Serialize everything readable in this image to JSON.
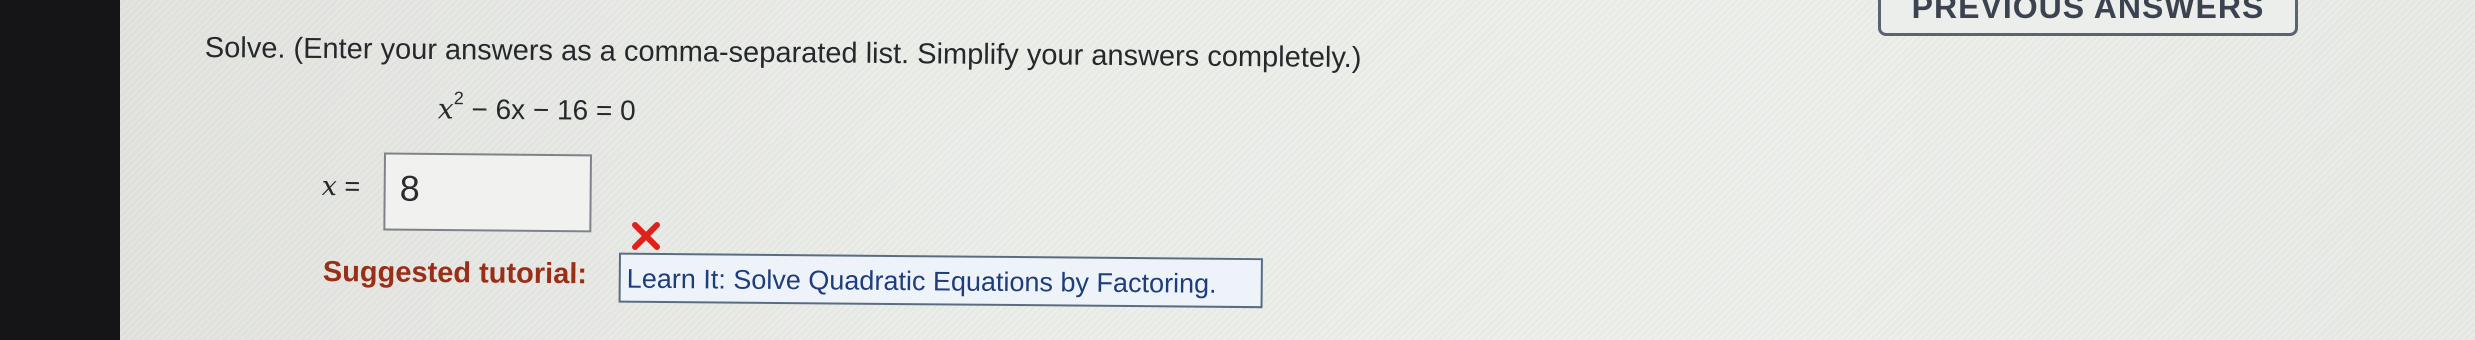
{
  "header": {
    "previous_answers_label": "PREVIOUS ANSWERS"
  },
  "question": {
    "instructions": "Solve. (Enter your answers as a comma-separated list. Simplify your answers completely.)",
    "equation": {
      "var": "x",
      "exponent": "2",
      "rest": " − 6x − 16 = 0"
    },
    "answer_var": "x",
    "answer_eq": " =",
    "answer_value": "8",
    "status_icon": "wrong-x-icon",
    "status_color": "#e0201b"
  },
  "tutorial": {
    "label": "Suggested tutorial:",
    "link_text": "Learn It: Solve Quadratic Equations by Factoring."
  }
}
